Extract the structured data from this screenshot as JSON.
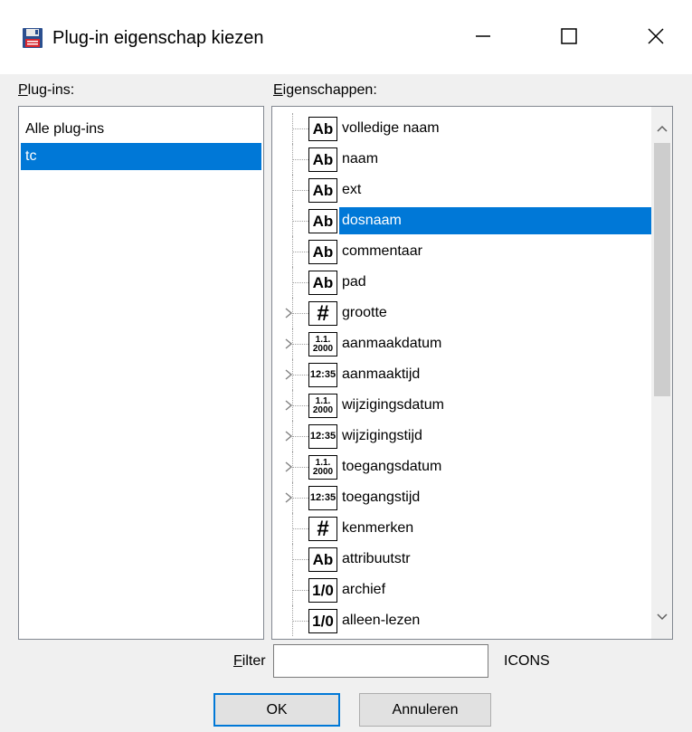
{
  "window": {
    "title": "Plug-in eigenschap kiezen",
    "icon": "floppy-disk-icon",
    "controls": [
      "minimize-icon",
      "maximize-icon",
      "close-icon"
    ]
  },
  "plugins": {
    "label_accel": "P",
    "label_rest": "lug-ins:",
    "items": [
      "Alle plug-ins",
      "tc"
    ],
    "selected": "tc"
  },
  "properties": {
    "label_accel": "E",
    "label_rest": "igenschappen:",
    "selected": "dosnaam",
    "items": [
      {
        "label": "volledige naam",
        "icon_text": "Ab",
        "kind": "ab",
        "expandable": false
      },
      {
        "label": "naam",
        "icon_text": "Ab",
        "kind": "ab",
        "expandable": false
      },
      {
        "label": "ext",
        "icon_text": "Ab",
        "kind": "ab",
        "expandable": false
      },
      {
        "label": "dosnaam",
        "icon_text": "Ab",
        "kind": "ab",
        "expandable": false
      },
      {
        "label": "commentaar",
        "icon_text": "Ab",
        "kind": "ab",
        "expandable": false
      },
      {
        "label": "pad",
        "icon_text": "Ab",
        "kind": "ab",
        "expandable": false
      },
      {
        "label": "grootte",
        "icon_text": "#",
        "kind": "num",
        "expandable": true
      },
      {
        "label": "aanmaakdatum",
        "icon_text": "1.1.\n2000",
        "kind": "date",
        "expandable": true
      },
      {
        "label": "aanmaaktijd",
        "icon_text": "12:35",
        "kind": "time",
        "expandable": true
      },
      {
        "label": "wijzigingsdatum",
        "icon_text": "1.1.\n2000",
        "kind": "date",
        "expandable": true
      },
      {
        "label": "wijzigingstijd",
        "icon_text": "12:35",
        "kind": "time",
        "expandable": true
      },
      {
        "label": "toegangsdatum",
        "icon_text": "1.1.\n2000",
        "kind": "date",
        "expandable": true
      },
      {
        "label": "toegangstijd",
        "icon_text": "12:35",
        "kind": "time",
        "expandable": true
      },
      {
        "label": "kenmerken",
        "icon_text": "#",
        "kind": "num",
        "expandable": false
      },
      {
        "label": "attribuutstr",
        "icon_text": "Ab",
        "kind": "ab",
        "expandable": false
      },
      {
        "label": "archief",
        "icon_text": "1/0",
        "kind": "bool",
        "expandable": false
      },
      {
        "label": "alleen-lezen",
        "icon_text": "1/0",
        "kind": "bool",
        "expandable": false
      }
    ]
  },
  "filter": {
    "label_accel": "F",
    "label_rest": "ilter",
    "value": "",
    "placeholder": "",
    "hint": "ICONS"
  },
  "buttons": {
    "ok": "OK",
    "cancel": "Annuleren"
  },
  "colors": {
    "selection": "#0078d7",
    "accent": "#0078d7"
  }
}
